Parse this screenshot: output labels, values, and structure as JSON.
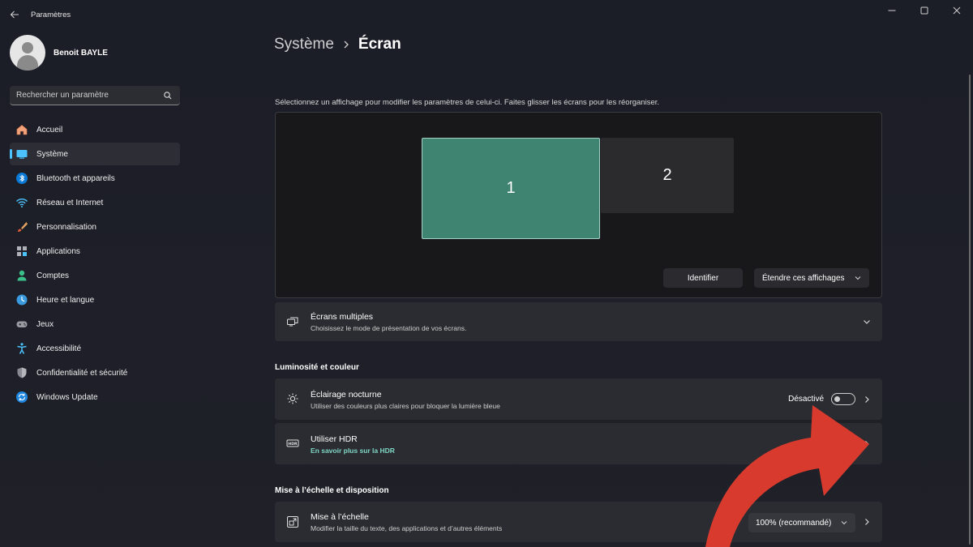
{
  "app": {
    "title": "Paramètres",
    "user_name": "Benoit BAYLE"
  },
  "search": {
    "placeholder": "Rechercher un paramètre"
  },
  "sidebar": {
    "items": [
      {
        "label": "Accueil",
        "icon": "home-icon"
      },
      {
        "label": "Système",
        "icon": "system-icon",
        "active": true
      },
      {
        "label": "Bluetooth et appareils",
        "icon": "bluetooth-icon"
      },
      {
        "label": "Réseau et Internet",
        "icon": "wifi-icon"
      },
      {
        "label": "Personnalisation",
        "icon": "brush-icon"
      },
      {
        "label": "Applications",
        "icon": "apps-icon"
      },
      {
        "label": "Comptes",
        "icon": "account-icon"
      },
      {
        "label": "Heure et langue",
        "icon": "globe-icon"
      },
      {
        "label": "Jeux",
        "icon": "gamepad-icon"
      },
      {
        "label": "Accessibilité",
        "icon": "accessibility-icon"
      },
      {
        "label": "Confidentialité et sécurité",
        "icon": "shield-icon"
      },
      {
        "label": "Windows Update",
        "icon": "update-icon"
      }
    ]
  },
  "breadcrumb": {
    "parent": "Système",
    "current": "Écran"
  },
  "display": {
    "instruction": "Sélectionnez un affichage pour modifier les paramètres de celui-ci. Faites glisser les écrans pour les réorganiser.",
    "monitor_1": "1",
    "monitor_2": "2",
    "identify_label": "Identifier",
    "extend_label": "Étendre ces affichages"
  },
  "multiple_displays": {
    "title": "Écrans multiples",
    "subtitle": "Choisissez le mode de présentation de vos écrans."
  },
  "brightness_section": {
    "title": "Luminosité et couleur",
    "night_light": {
      "title": "Éclairage nocturne",
      "subtitle": "Utiliser des couleurs plus claires pour bloquer la lumière bleue",
      "state": "Désactivé"
    },
    "hdr": {
      "title": "Utiliser HDR",
      "link": "En savoir plus sur la HDR"
    }
  },
  "scale_section": {
    "title": "Mise à l’échelle et disposition",
    "scale": {
      "title": "Mise à l’échelle",
      "subtitle": "Modifier la taille du texte, des applications et d’autres éléments",
      "value": "100% (recommandé)"
    }
  },
  "colors": {
    "accent": "#4cc2ff",
    "monitor_selected": "#3f8470",
    "annotation_arrow": "#d93a2e"
  }
}
